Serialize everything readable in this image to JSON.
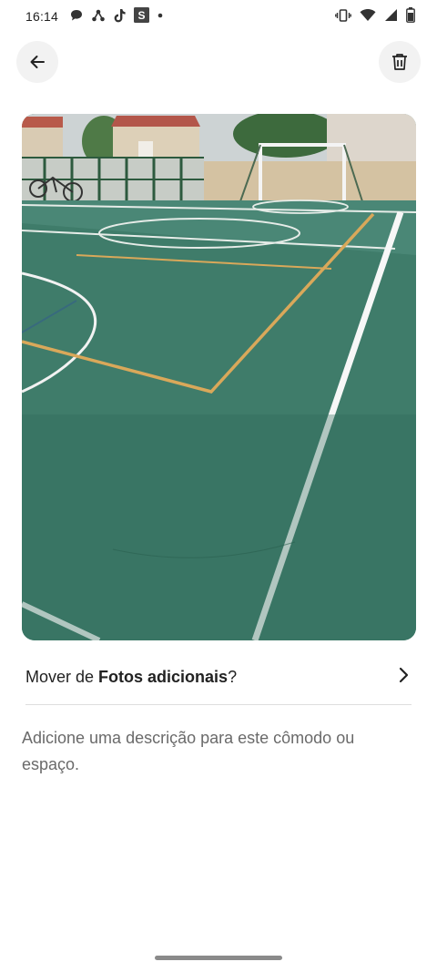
{
  "status_bar": {
    "time": "16:14",
    "notification_icons": [
      "chat-bubble-icon",
      "nodes-icon",
      "tiktok-icon",
      "s-app-icon",
      "dot-icon"
    ],
    "system_icons": [
      "vibrate-icon",
      "wifi-icon",
      "signal-icon",
      "battery-icon"
    ]
  },
  "toolbar": {
    "back_icon": "arrow-left-icon",
    "delete_icon": "trash-icon"
  },
  "photo": {
    "subject": "sports court"
  },
  "move_row": {
    "prefix": "Mover de ",
    "album": "Fotos adicionais",
    "suffix": "?",
    "icon": "chevron-right-icon"
  },
  "description": {
    "placeholder": "Adicione uma descrição para este cômodo ou espaço."
  },
  "colors": {
    "court_green": "#3f7c6a",
    "court_line_yellow": "#d9a85a",
    "button_bg": "#f2f2f2",
    "secondary_text": "#6a6a6a"
  }
}
